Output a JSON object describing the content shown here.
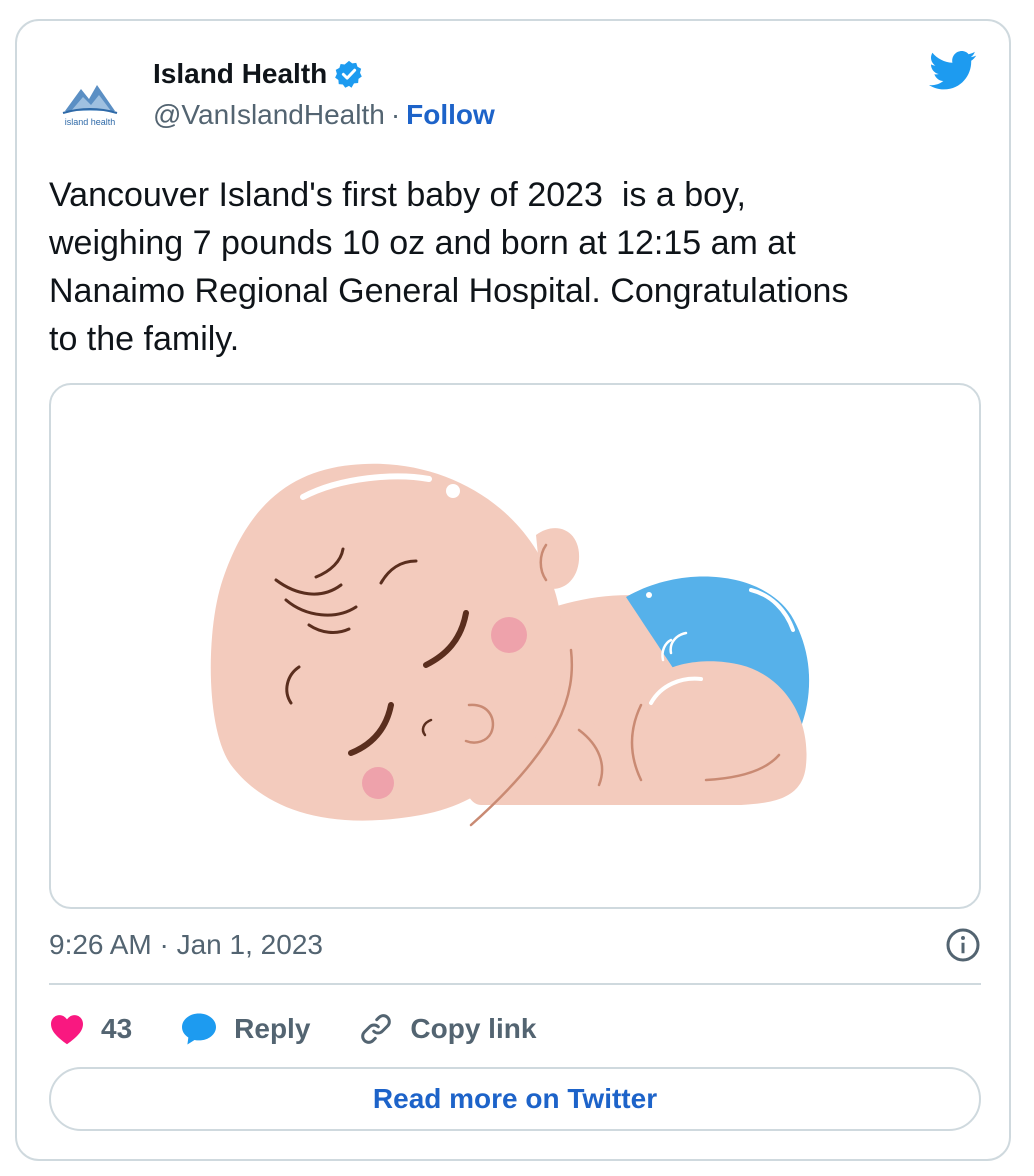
{
  "author": {
    "name": "Island Health",
    "handle": "@VanIslandHealth",
    "separator": "·",
    "follow_label": "Follow",
    "verified": true,
    "logo_text": "island health"
  },
  "tweet": {
    "text": "Vancouver Island's first baby of 2023  is a boy,\nweighing 7 pounds 10 oz and born at 12:15 am at\nNanaimo Regional General Hospital. Congratulations\nto the family.",
    "timestamp": "9:26 AM · Jan 1, 2023"
  },
  "actions": {
    "likes_count": "43",
    "reply_label": "Reply",
    "copy_link_label": "Copy link"
  },
  "read_more_label": "Read more on Twitter",
  "icons": {
    "brand": "twitter-bird-icon",
    "verified": "verified-badge-icon",
    "info": "info-icon",
    "like": "heart-icon",
    "reply": "speech-bubble-icon",
    "copy": "link-icon"
  },
  "colors": {
    "twitter_blue": "#1d9bf0",
    "link_blue": "#1d63c9",
    "heart_pink": "#f91880",
    "muted_text": "#536471",
    "border": "#cfd9de"
  }
}
